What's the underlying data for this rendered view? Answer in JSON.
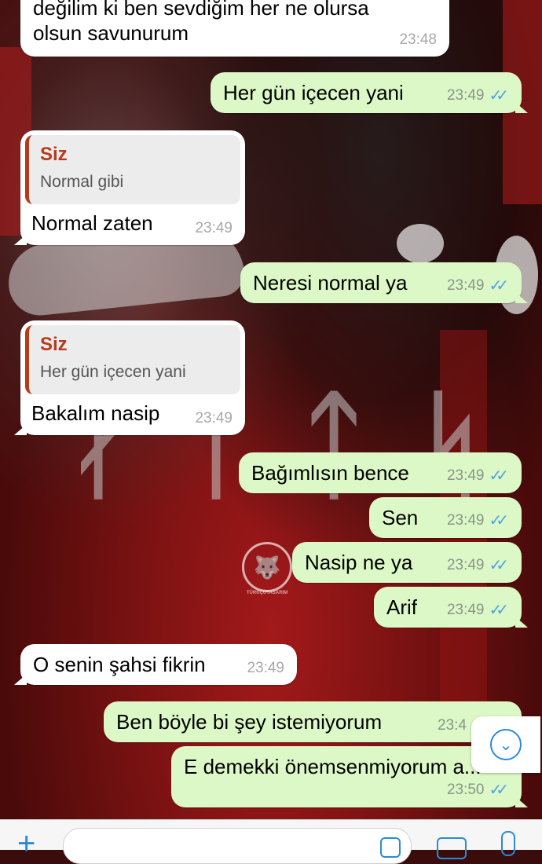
{
  "messages": [
    {
      "text_lines": [
        "değilim ki ben sevdiğim her ne olursa",
        "olsun savunurum"
      ],
      "time": "23:48"
    },
    {
      "text": "Her gün içecen yani",
      "time": "23:49"
    },
    {
      "quote_author": "Siz",
      "quote_text": "Normal gibi",
      "text": "Normal zaten",
      "time": "23:49"
    },
    {
      "text": "Neresi normal ya",
      "time": "23:49"
    },
    {
      "quote_author": "Siz",
      "quote_text": "Her gün içecen yani",
      "text": "Bakalım nasip",
      "time": "23:49"
    },
    {
      "text": "Bağımlısın bence",
      "time": "23:49"
    },
    {
      "text": "Sen",
      "time": "23:49"
    },
    {
      "text": "Nasip ne ya",
      "time": "23:49"
    },
    {
      "text": "Arif",
      "time": "23:49"
    },
    {
      "text": "O senin şahsi fikrin",
      "time": "23:49"
    },
    {
      "text": "Ben böyle bi şey istemiyorum",
      "time": "23:4"
    },
    {
      "text": "E demekki önemsenmiyorum a...",
      "time": "23:50"
    }
  ],
  "watermark": "TÜRKÇÜTASARIM",
  "colors": {
    "incoming": "#ffffff",
    "outgoing": "#dcf8c6",
    "accent": "#2b8ad8",
    "read_ticks": "#4fa3e6",
    "quote_author": "#b73a1a"
  },
  "icons": {
    "read": "double-check-icon",
    "scroll": "chevron-down-icon",
    "attach": "plus-icon",
    "sticker": "sticker-icon",
    "camera": "camera-icon",
    "mic": "mic-icon"
  }
}
